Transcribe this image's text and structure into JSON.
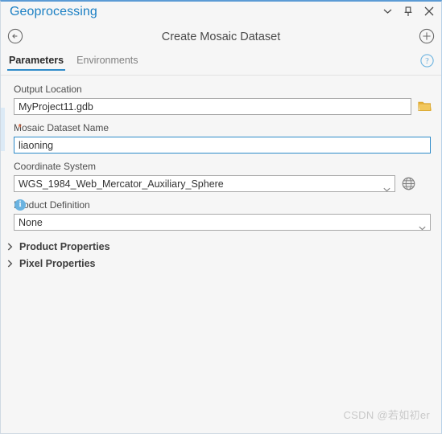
{
  "window": {
    "title": "Geoprocessing",
    "controls": [
      {
        "name": "minimize-chevron",
        "icon": "chevron-down-icon",
        "tooltip": "Minimize"
      },
      {
        "name": "pin",
        "icon": "pin-icon",
        "tooltip": "Auto Hide"
      },
      {
        "name": "close",
        "icon": "close-icon",
        "tooltip": "Close"
      }
    ]
  },
  "tool": {
    "back_label": "Back",
    "title": "Create Mosaic Dataset",
    "add_label": "Add"
  },
  "tabs": [
    {
      "label": "Parameters",
      "active": true
    },
    {
      "label": "Environments",
      "active": false
    }
  ],
  "help": {
    "label": "Help"
  },
  "fields": {
    "output_location": {
      "label": "Output Location",
      "value": "MyProject11.gdb",
      "placeholder": "",
      "browse_label": "Browse"
    },
    "mosaic_dataset_name": {
      "label": "Mosaic Dataset Name",
      "value": "liaoning",
      "placeholder": "",
      "required_marker": "*",
      "required": true
    },
    "coordinate_system": {
      "label": "Coordinate System",
      "value": "WGS_1984_Web_Mercator_Auxiliary_Sphere",
      "placeholder": "",
      "globe_label": "Select coordinate system"
    },
    "product_definition": {
      "label": "Product Definition",
      "value": "None",
      "info_marker": "i"
    }
  },
  "expanders": [
    {
      "label": "Product Properties",
      "expanded": false
    },
    {
      "label": "Pixel Properties",
      "expanded": false
    }
  ],
  "watermark": {
    "text": "CSDN @若如初er"
  },
  "colors": {
    "accent_blue": "#1c80c4",
    "tab_underline": "#2e8bc9",
    "panel_bg": "#f6f6f6",
    "required_star": "#e8683c",
    "info_blue": "#6bb3e0",
    "folder_gold": "#e8b23a",
    "focus_border": "#2e8bc9"
  }
}
